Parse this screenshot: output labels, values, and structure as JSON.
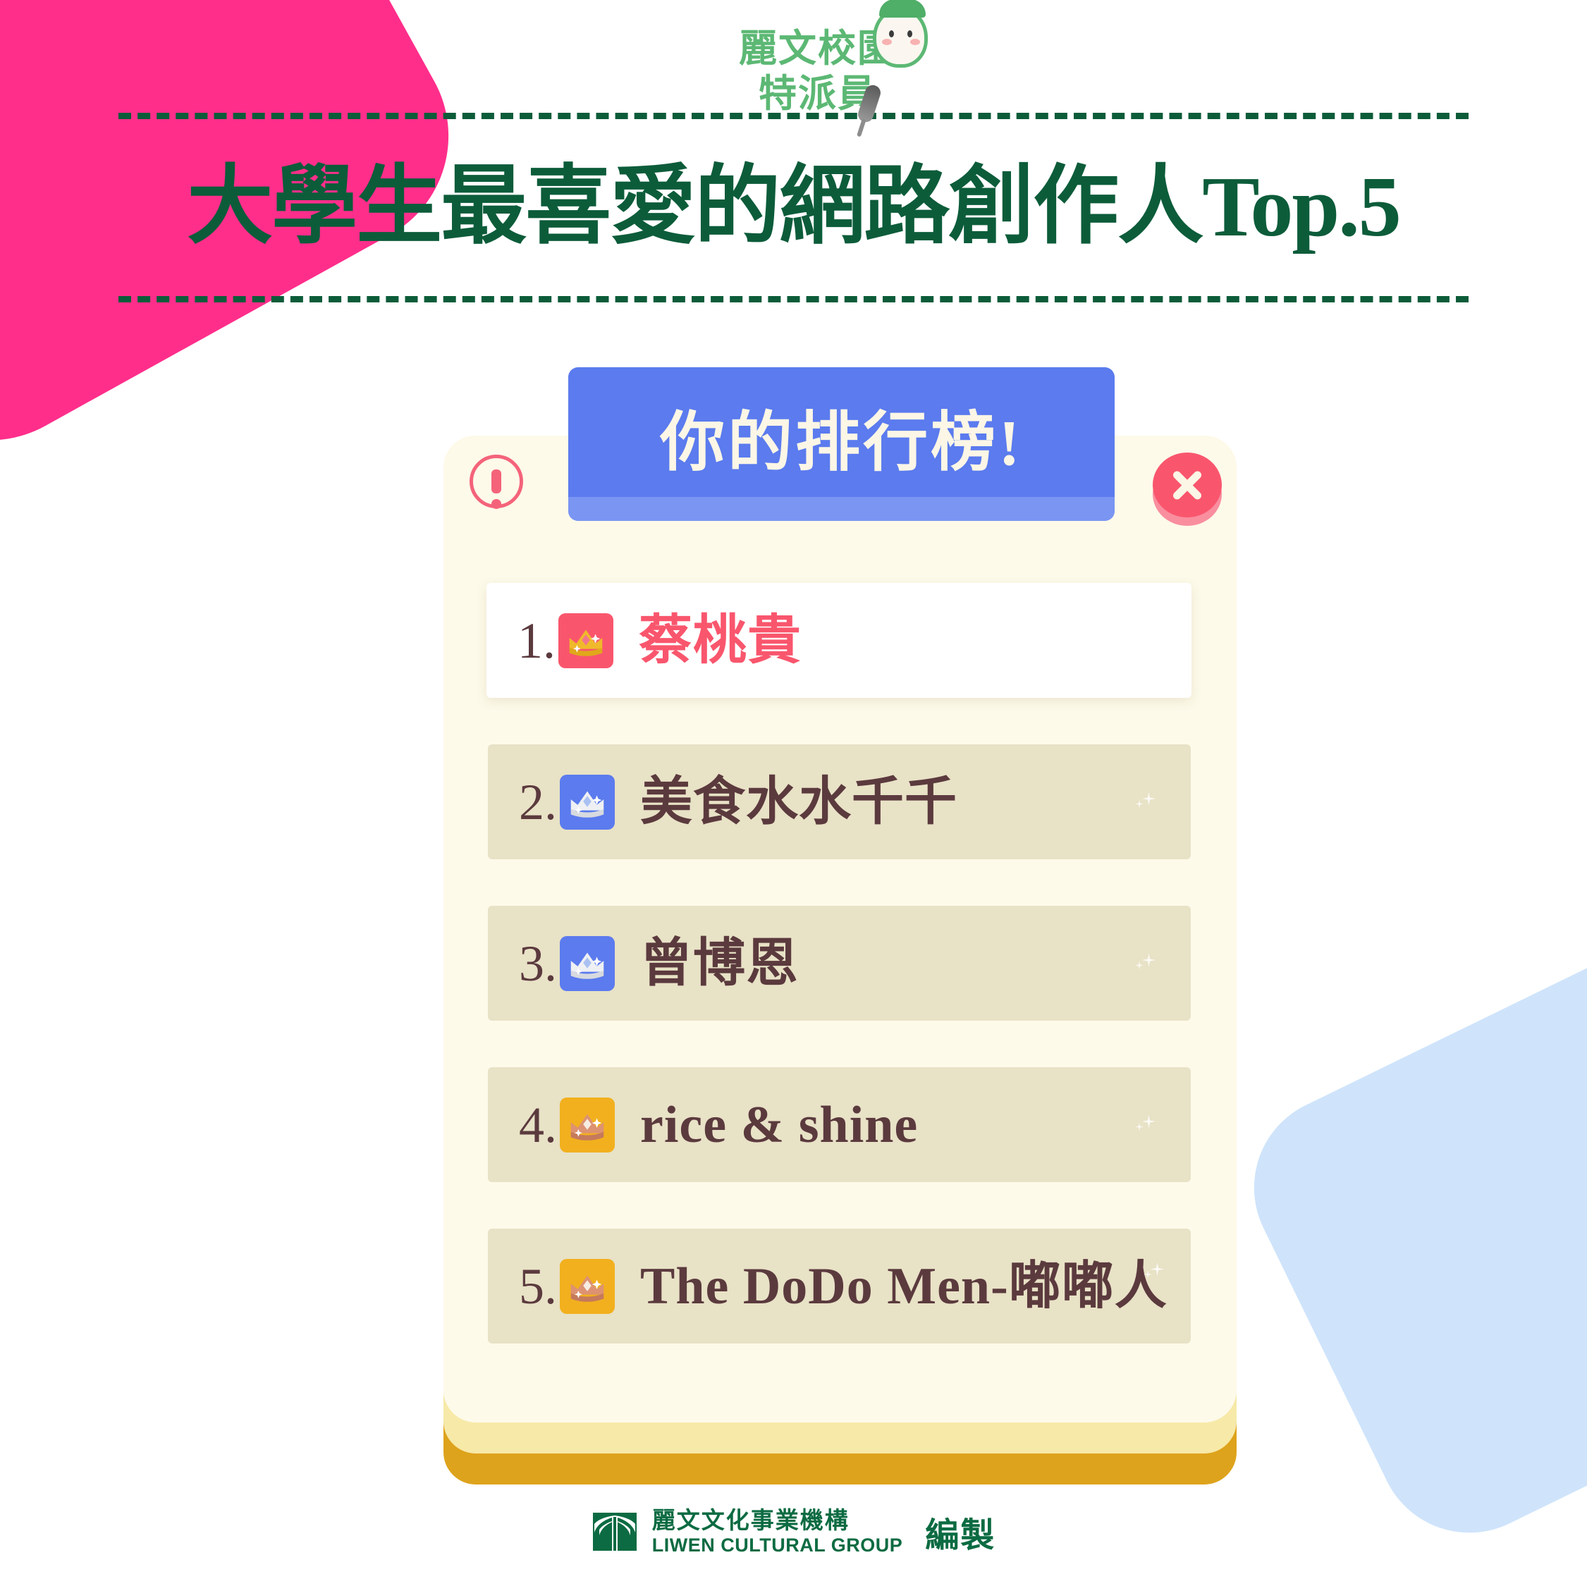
{
  "brand": {
    "logo_line1": "麗文校園",
    "logo_line2": "特派員",
    "mascot_icon": "egg-mascot-icon",
    "mic_icon": "microphone-icon"
  },
  "header": {
    "title": "大學生最喜愛的網路創作人Top.5",
    "accent_green": "#0C5C3A",
    "accent_pink": "#FF2E8B",
    "accent_blue": "#CFE4FB"
  },
  "modal": {
    "header_label": "你的排行榜!",
    "header_color": "#5B7BEE",
    "header_text_color": "#FBF6E6",
    "card_color": "#FDFAEA",
    "alert_icon": "alert-exclamation-icon",
    "close_icon": "close-x-icon",
    "close_color": "#F9566D"
  },
  "ranking": [
    {
      "number": "1.",
      "name": "蔡桃貴",
      "badge_icon": "gold-crown-icon",
      "badge_bg": "#F9566D",
      "crown_color": "#F0B92B",
      "highlighted": true
    },
    {
      "number": "2.",
      "name": "美食水水千千",
      "badge_icon": "silver-crown-icon",
      "badge_bg": "#5B7BEE",
      "crown_color": "#E3E5E8",
      "highlighted": false
    },
    {
      "number": "3.",
      "name": "曾博恩",
      "badge_icon": "silver-crown-icon",
      "badge_bg": "#5B7BEE",
      "crown_color": "#E3E5E8",
      "highlighted": false
    },
    {
      "number": "4.",
      "name": "rice & shine",
      "badge_icon": "bronze-crown-icon",
      "badge_bg": "#F2B01E",
      "crown_color": "#DD9272",
      "highlighted": false
    },
    {
      "number": "5.",
      "name": "The DoDo Men-嘟嘟人",
      "badge_icon": "bronze-crown-icon",
      "badge_bg": "#F2B01E",
      "crown_color": "#DD9272",
      "highlighted": false
    }
  ],
  "footer": {
    "mark_icon": "liwen-tree-logo-icon",
    "org_cn": "麗文文化事業機構",
    "org_en": "LIWEN CULTURAL GROUP",
    "suffix": "編製",
    "color": "#0C6B42"
  }
}
